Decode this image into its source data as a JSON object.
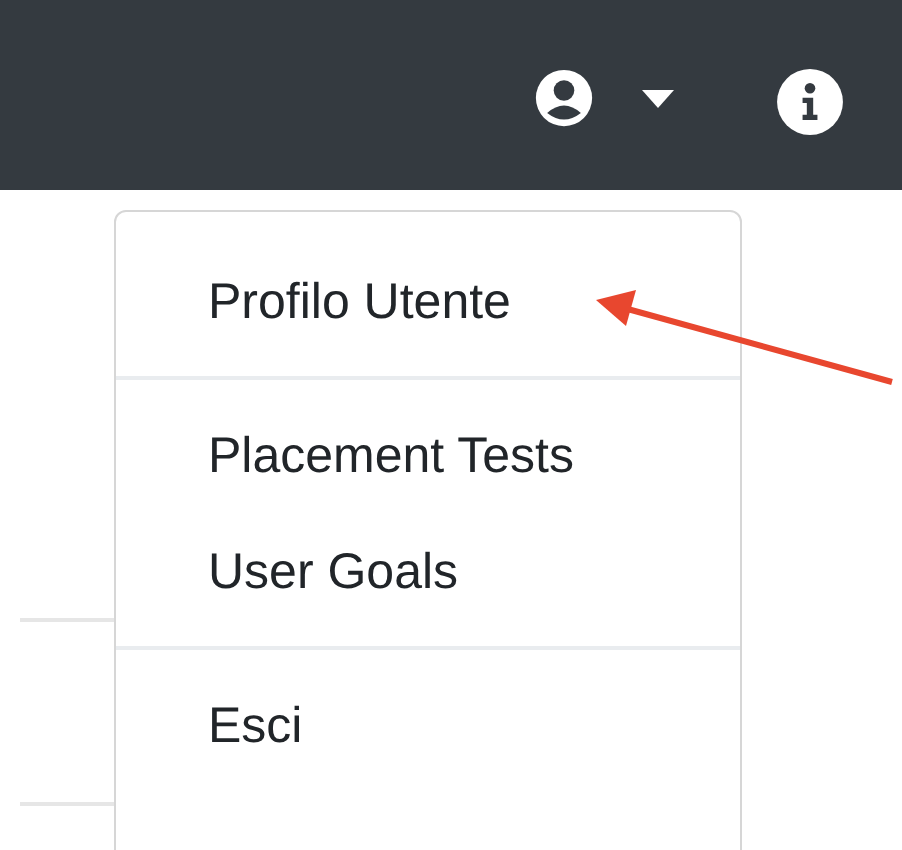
{
  "user_menu": {
    "items": [
      {
        "label": "Profilo Utente",
        "divider_after": true
      },
      {
        "label": "Placement Tests",
        "divider_after": false
      },
      {
        "label": "User Goals",
        "divider_after": true
      },
      {
        "label": "Esci",
        "divider_after": false
      }
    ]
  }
}
